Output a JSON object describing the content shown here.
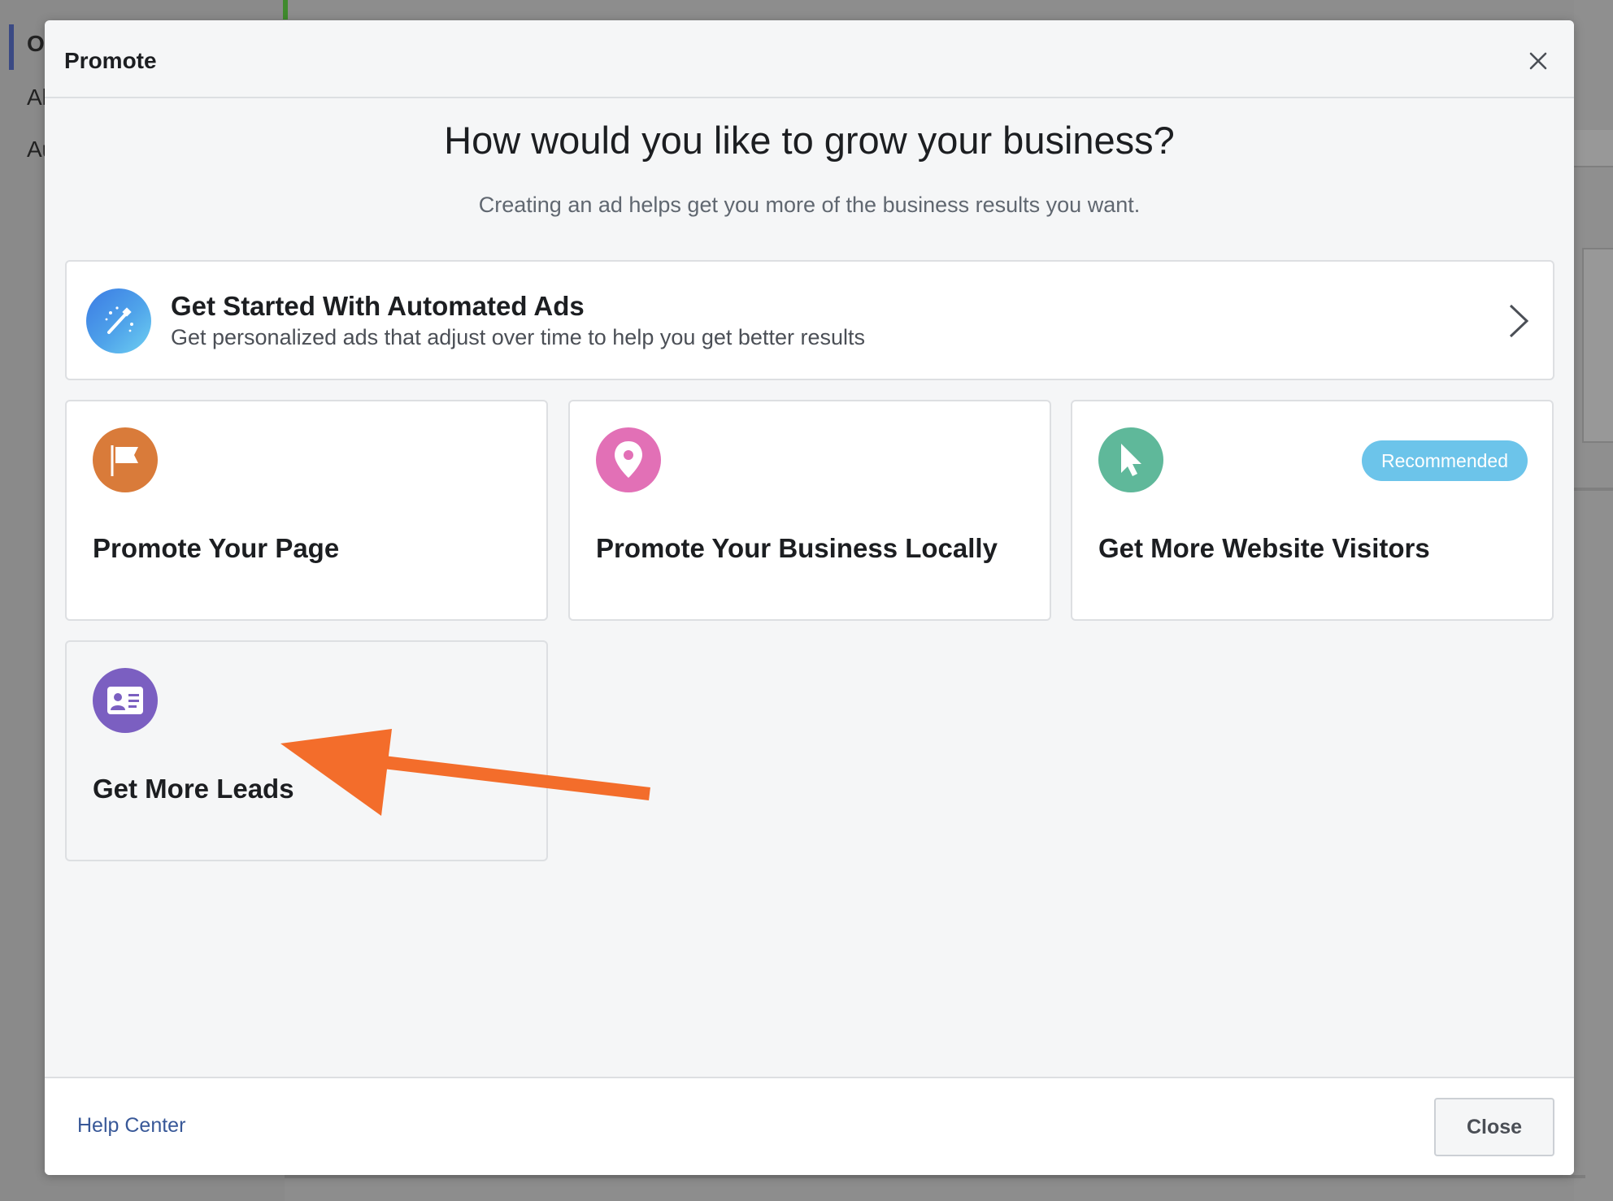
{
  "background": {
    "sidebar_items": [
      "O",
      "Al",
      "Au"
    ]
  },
  "modal": {
    "title": "Promote",
    "heading": "How would you like to grow your business?",
    "subheading": "Creating an ad helps get you more of the business results you want.",
    "automated_ads": {
      "title": "Get Started With Automated Ads",
      "description": "Get personalized ads that adjust over time to help you get better results",
      "icon": "magic-wand-icon"
    },
    "options": [
      {
        "label": "Promote Your Page",
        "icon": "flag-icon",
        "color": "#d97b3a"
      },
      {
        "label": "Promote Your Business Locally",
        "icon": "location-pin-icon",
        "color": "#e270b6"
      },
      {
        "label": "Get More Website Visitors",
        "icon": "cursor-icon",
        "color": "#5fb89a",
        "badge": "Recommended"
      },
      {
        "label": "Get More Leads",
        "icon": "contact-card-icon",
        "color": "#7b5fc1"
      }
    ],
    "footer": {
      "help_link": "Help Center",
      "close_button": "Close"
    }
  },
  "annotation": {
    "arrow_color": "#f36d2b"
  }
}
